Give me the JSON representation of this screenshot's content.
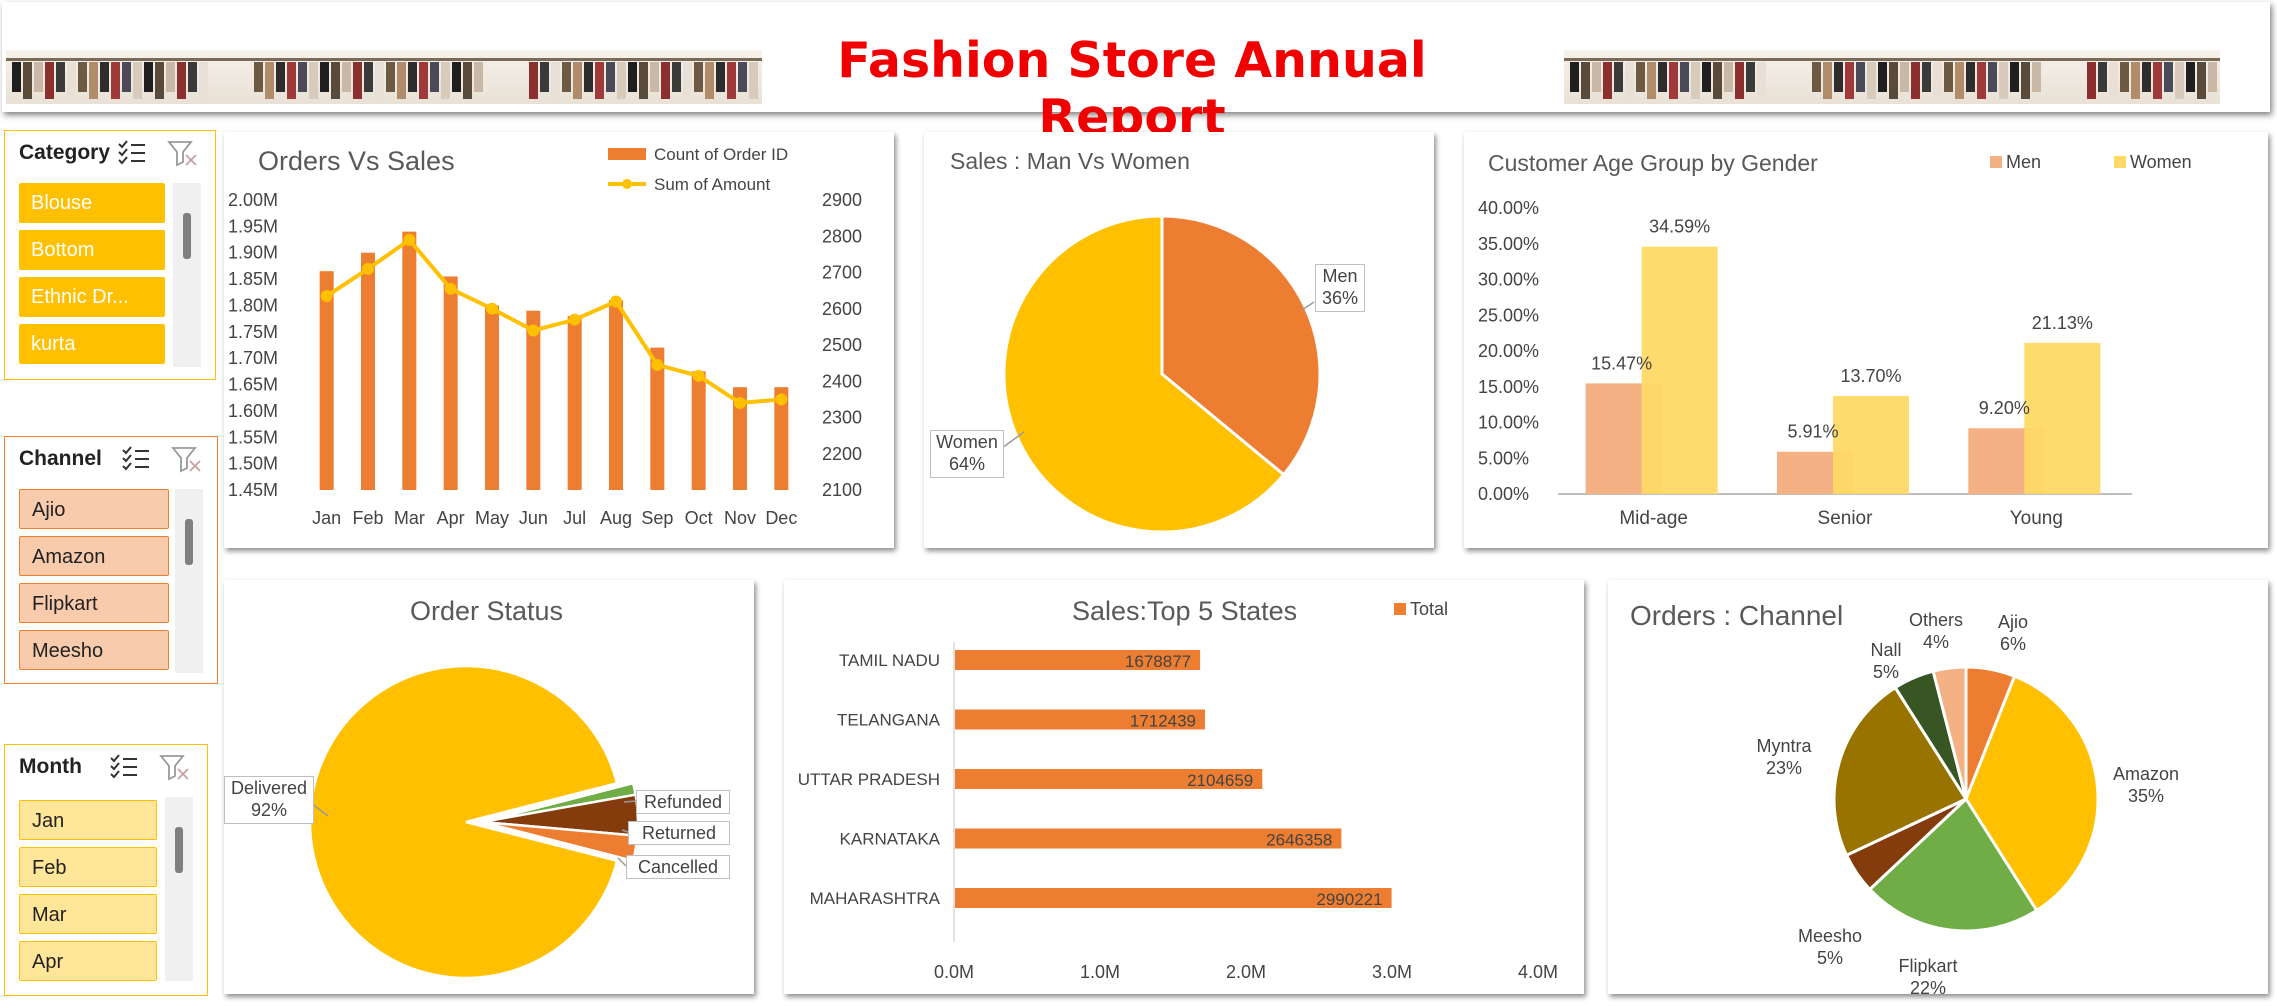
{
  "banner": {
    "title": "Fashion Store Annual Report"
  },
  "slicers": {
    "category": {
      "title": "Category",
      "items": [
        "Blouse",
        "Bottom",
        "Ethnic Dr...",
        "kurta"
      ],
      "color": "#FFC000"
    },
    "channel": {
      "title": "Channel",
      "items": [
        "Ajio",
        "Amazon",
        "Flipkart",
        "Meesho"
      ],
      "color": "#F8CBAD"
    },
    "month": {
      "title": "Month",
      "items": [
        "Jan",
        "Feb",
        "Mar",
        "Apr"
      ],
      "color": "#FFE699"
    }
  },
  "orders_vs_sales": {
    "title": "Orders Vs Sales",
    "legend": {
      "bars": "Count of Order ID",
      "line": "Sum of Amount"
    },
    "left_ticks": [
      "2.00M",
      "1.95M",
      "1.90M",
      "1.85M",
      "1.80M",
      "1.75M",
      "1.70M",
      "1.65M",
      "1.60M",
      "1.55M",
      "1.50M",
      "1.45M"
    ],
    "right_ticks": [
      "2900",
      "2800",
      "2700",
      "2600",
      "2500",
      "2400",
      "2300",
      "2200",
      "2100"
    ]
  },
  "man_vs_women": {
    "title": "Sales : Man Vs Women",
    "men_label": "Men",
    "men_pct": "36%",
    "women_label": "Women",
    "women_pct": "64%"
  },
  "age_group": {
    "title": "Customer Age Group by Gender",
    "legend_men": "Men",
    "legend_women": "Women",
    "ticks": [
      "40.00%",
      "35.00%",
      "30.00%",
      "25.00%",
      "20.00%",
      "15.00%",
      "10.00%",
      "5.00%",
      "0.00%"
    ],
    "labels": [
      "15.47%",
      "34.59%",
      "5.91%",
      "13.70%",
      "9.20%",
      "21.13%"
    ]
  },
  "order_status": {
    "title": "Order Status",
    "delivered": "Delivered",
    "delivered_pct": "92%",
    "refunded": "Refunded",
    "returned": "Returned",
    "cancelled": "Cancelled"
  },
  "top_states": {
    "title": "Sales:Top 5 States",
    "legend": "Total",
    "ticks": [
      "0.0M",
      "1.0M",
      "2.0M",
      "3.0M",
      "4.0M"
    ]
  },
  "orders_channel": {
    "title": "Orders : Channel",
    "labels": [
      {
        "name": "Ajio",
        "pct": "6%"
      },
      {
        "name": "Amazon",
        "pct": "35%"
      },
      {
        "name": "Flipkart",
        "pct": "22%"
      },
      {
        "name": "Meesho",
        "pct": "5%"
      },
      {
        "name": "Myntra",
        "pct": "23%"
      },
      {
        "name": "Nall",
        "pct": "5%"
      },
      {
        "name": "Others",
        "pct": "4%"
      }
    ]
  },
  "chart_data": [
    {
      "type": "bar",
      "title": "Orders Vs Sales",
      "categories": [
        "Jan",
        "Feb",
        "Mar",
        "Apr",
        "May",
        "Jun",
        "Jul",
        "Aug",
        "Sep",
        "Oct",
        "Nov",
        "Dec"
      ],
      "series": [
        {
          "name": "Count of Order ID",
          "axis": "left",
          "values": [
            1.865,
            1.9,
            1.94,
            1.855,
            1.8,
            1.79,
            1.78,
            1.81,
            1.72,
            1.675,
            1.645,
            1.645
          ]
        },
        {
          "name": "Sum of Amount",
          "type": "line",
          "axis": "right",
          "values": [
            2635,
            2710,
            2790,
            2655,
            2600,
            2540,
            2570,
            2620,
            2445,
            2415,
            2340,
            2350
          ]
        }
      ],
      "ylim": [
        1.45,
        2.0
      ],
      "y2lim": [
        2100,
        2900
      ]
    },
    {
      "type": "pie",
      "title": "Sales : Man Vs Women",
      "categories": [
        "Men",
        "Women"
      ],
      "values": [
        36,
        64
      ],
      "colors": [
        "#ED7D31",
        "#FFC000"
      ]
    },
    {
      "type": "bar",
      "title": "Customer Age Group by Gender",
      "categories": [
        "Mid-age",
        "Senior",
        "Young"
      ],
      "series": [
        {
          "name": "Men",
          "values": [
            15.47,
            5.91,
            9.2
          ],
          "color": "#F4B183"
        },
        {
          "name": "Women",
          "values": [
            34.59,
            13.7,
            21.13
          ],
          "color": "#FFD966"
        }
      ],
      "ylim": [
        0,
        40
      ]
    },
    {
      "type": "pie",
      "title": "Order Status",
      "categories": [
        "Delivered",
        "Refunded",
        "Returned",
        "Cancelled"
      ],
      "values": [
        92,
        1.2,
        4.2,
        2.6
      ],
      "colors": [
        "#FFC000",
        "#70AD47",
        "#843C0C",
        "#ED7D31"
      ]
    },
    {
      "type": "bar",
      "orientation": "horizontal",
      "title": "Sales:Top 5 States",
      "categories": [
        "TAMIL NADU",
        "TELANGANA",
        "UTTAR PRADESH",
        "KARNATAKA",
        "MAHARASHTRA"
      ],
      "series": [
        {
          "name": "Total",
          "values": [
            1678877,
            1712439,
            2104659,
            2646358,
            2990221
          ]
        }
      ],
      "xlim": [
        0,
        4000000
      ],
      "color": "#ED7D31"
    },
    {
      "type": "pie",
      "title": "Orders : Channel",
      "categories": [
        "Ajio",
        "Amazon",
        "Flipkart",
        "Meesho",
        "Myntra",
        "Nall",
        "Others"
      ],
      "values": [
        6,
        35,
        22,
        5,
        23,
        5,
        4
      ],
      "colors": [
        "#ED7D31",
        "#FFC000",
        "#70AD47",
        "#843C0C",
        "#997300",
        "#375623",
        "#F4B183"
      ]
    }
  ]
}
